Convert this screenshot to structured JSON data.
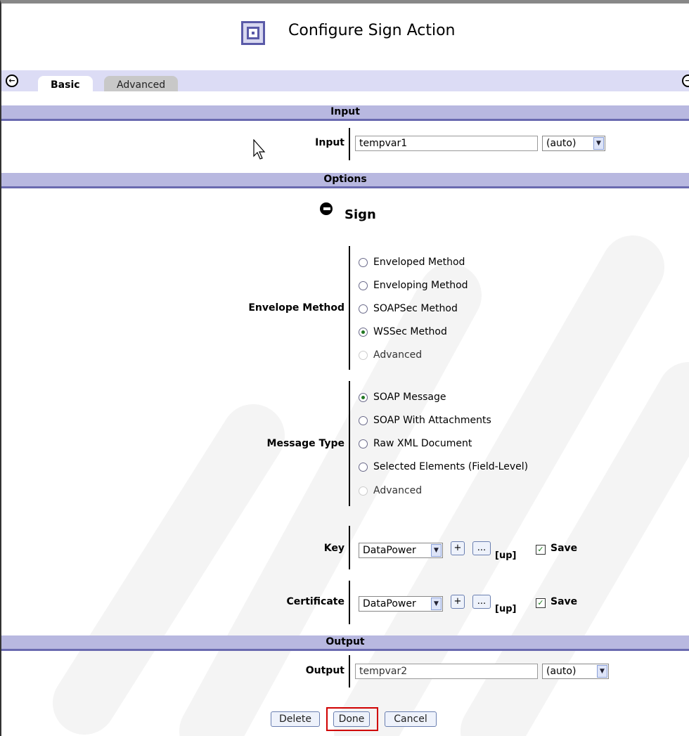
{
  "title": "Configure Sign Action",
  "tabs": [
    {
      "label": "Basic",
      "active": true
    },
    {
      "label": "Advanced",
      "active": false
    }
  ],
  "sections": {
    "input": "Input",
    "options": "Options",
    "output": "Output"
  },
  "input": {
    "label": "Input",
    "value": "tempvar1",
    "type_select": "(auto)"
  },
  "sign": {
    "heading": "Sign"
  },
  "envelope_method": {
    "label": "Envelope Method",
    "options": [
      {
        "label": "Enveloped Method",
        "selected": false,
        "disabled": false
      },
      {
        "label": "Enveloping Method",
        "selected": false,
        "disabled": false
      },
      {
        "label": "SOAPSec Method",
        "selected": false,
        "disabled": false
      },
      {
        "label": "WSSec Method",
        "selected": true,
        "disabled": false
      },
      {
        "label": "Advanced",
        "selected": false,
        "disabled": true
      }
    ]
  },
  "message_type": {
    "label": "Message Type",
    "options": [
      {
        "label": "SOAP Message",
        "selected": true,
        "disabled": false
      },
      {
        "label": "SOAP With Attachments",
        "selected": false,
        "disabled": false
      },
      {
        "label": "Raw XML Document",
        "selected": false,
        "disabled": false
      },
      {
        "label": "Selected Elements (Field-Level)",
        "selected": false,
        "disabled": false
      },
      {
        "label": "Advanced",
        "selected": false,
        "disabled": true
      }
    ]
  },
  "key": {
    "label": "Key",
    "value": "DataPower",
    "add": "+",
    "edit": "...",
    "up": "[up]",
    "save_label": "Save",
    "save_checked": true
  },
  "certificate": {
    "label": "Certificate",
    "value": "DataPower",
    "add": "+",
    "edit": "...",
    "up": "[up]",
    "save_label": "Save",
    "save_checked": true
  },
  "output": {
    "label": "Output",
    "value": "tempvar2",
    "type_select": "(auto)"
  },
  "buttons": {
    "delete": "Delete",
    "done": "Done",
    "cancel": "Cancel"
  },
  "colors": {
    "section_bg": "#b8b8e0",
    "tabbar_bg": "#dcdcf5",
    "highlight": "#d00000",
    "radio_selected": "#227722"
  }
}
